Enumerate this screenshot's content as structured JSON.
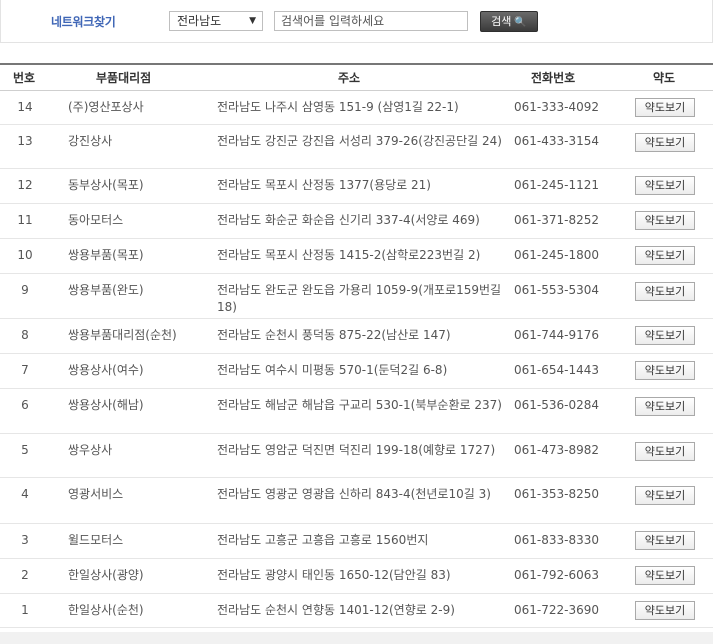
{
  "search": {
    "title": "네트워크찾기",
    "region": "전라남도",
    "region_arrow": "▼",
    "placeholder": "검색어를 입력하세요",
    "button": "검색",
    "button_icon": "search-icon"
  },
  "table": {
    "headers": [
      "번호",
      "부품대리점",
      "주소",
      "전화번호",
      "약도"
    ],
    "rows": [
      {
        "no": "14",
        "name": "(주)영산포상사",
        "addr": "전라남도 나주시 삼영동 151-9 (삼영1길 22-1)",
        "tel": "061-333-4092",
        "map": "약도보기"
      },
      {
        "no": "13",
        "name": "강진상사",
        "addr": "전라남도 강진군 강진읍 서성리 379-26(강진공단길 24)",
        "tel": "061-433-3154",
        "map": "약도보기"
      },
      {
        "no": "12",
        "name": "동부상사(목포)",
        "addr": "전라남도 목포시 산정동 1377(용당로 21)",
        "tel": "061-245-1121",
        "map": "약도보기"
      },
      {
        "no": "11",
        "name": "동아모터스",
        "addr": "전라남도 화순군 화순읍 신기리 337-4(서양로 469)",
        "tel": "061-371-8252",
        "map": "약도보기"
      },
      {
        "no": "10",
        "name": "쌍용부품(목포)",
        "addr": "전라남도 목포시 산정동 1415-2(삼학로223번길 2)",
        "tel": "061-245-1800",
        "map": "약도보기"
      },
      {
        "no": "9",
        "name": "쌍용부품(완도)",
        "addr": "전라남도 완도군 완도읍 가용리 1059-9(개포로159번길 18)",
        "tel": "061-553-5304",
        "map": "약도보기"
      },
      {
        "no": "8",
        "name": "쌍용부품대리점(순천)",
        "addr": "전라남도 순천시 풍덕동 875-22(남산로 147)",
        "tel": "061-744-9176",
        "map": "약도보기"
      },
      {
        "no": "7",
        "name": "쌍용상사(여수)",
        "addr": "전라남도 여수시 미평동 570-1(둔덕2길 6-8)",
        "tel": "061-654-1443",
        "map": "약도보기"
      },
      {
        "no": "6",
        "name": "쌍용상사(해남)",
        "addr": "전라남도 해남군 해남읍 구교리 530-1(북부순환로 237)",
        "tel": "061-536-0284",
        "map": "약도보기"
      },
      {
        "no": "5",
        "name": "쌍우상사",
        "addr": "전라남도 영암군 덕진면 덕진리 199-18(예향로 1727)",
        "tel": "061-473-8982",
        "map": "약도보기"
      },
      {
        "no": "4",
        "name": "영광서비스",
        "addr": "전라남도 영광군 영광읍 신하리 843-4(천년로10길 3)",
        "tel": "061-353-8250",
        "map": "약도보기"
      },
      {
        "no": "3",
        "name": "윌드모터스",
        "addr": "전라남도 고흥군 고흥읍 고흥로 1560번지",
        "tel": "061-833-8330",
        "map": "약도보기"
      },
      {
        "no": "2",
        "name": "한일상사(광양)",
        "addr": "전라남도 광양시 태인동 1650-12(담안길 83)",
        "tel": "061-792-6063",
        "map": "약도보기"
      },
      {
        "no": "1",
        "name": "한일상사(순천)",
        "addr": "전라남도 순천시 연향동 1401-12(연향로 2-9)",
        "tel": "061-722-3690",
        "map": "약도보기"
      }
    ]
  }
}
